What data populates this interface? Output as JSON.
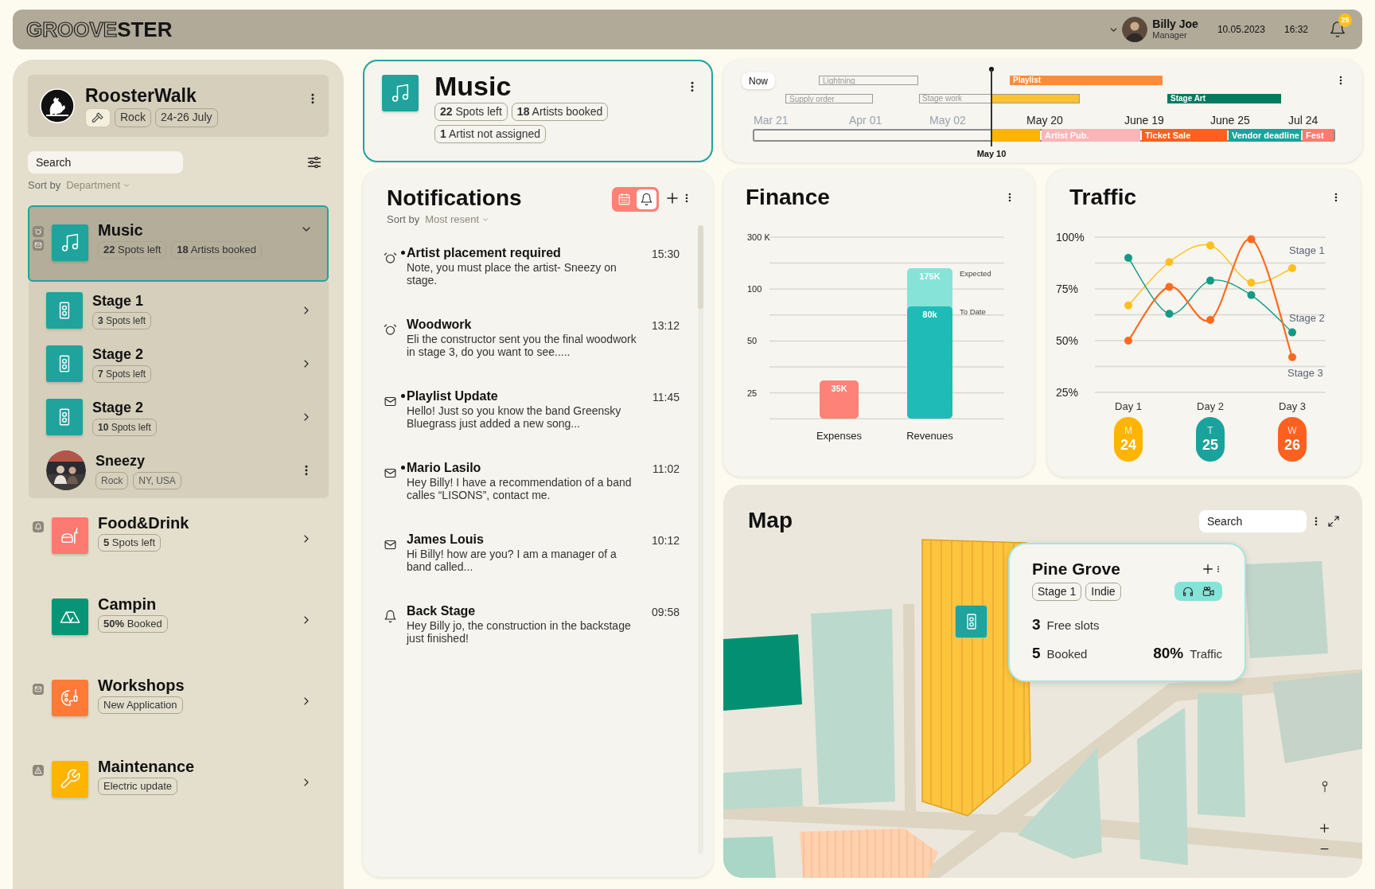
{
  "header": {
    "logo_outline": "GROOVE",
    "logo_solid": "STER",
    "user": {
      "name": "Billy Joe",
      "role": "Manager"
    },
    "date": "10.05.2023",
    "time": "16:32",
    "notification_count": "25"
  },
  "sidebar": {
    "festival": {
      "name": "RoosterWalk",
      "tags": [
        "Rock",
        "24-26 July"
      ]
    },
    "search": {
      "placeholder": "Search"
    },
    "sort": {
      "label": "Sort by",
      "value": "Department"
    },
    "items": [
      {
        "kind": "department",
        "title": "Music",
        "badges": [
          "**22** Spots left",
          "**18** Artists booked"
        ],
        "color": "#1fa39c",
        "selected": true,
        "expanded": true,
        "children": [
          {
            "kind": "stage",
            "title": "Stage 1",
            "badges": [
              "**3** Spots left"
            ]
          },
          {
            "kind": "stage",
            "title": "Stage 2",
            "badges": [
              "**7** Spots left"
            ]
          },
          {
            "kind": "stage",
            "title": "Stage 2",
            "badges": [
              "**10** Spots left"
            ]
          },
          {
            "kind": "artist",
            "title": "Sneezy",
            "badges": [
              "Rock",
              "NY, USA"
            ]
          }
        ]
      },
      {
        "kind": "department",
        "title": "Food&Drink",
        "badges": [
          "**5** Spots left"
        ],
        "color": "#fd7a72",
        "selected": false,
        "expanded": false
      },
      {
        "kind": "department",
        "title": "Campin",
        "badges": [
          "**50%** Booked"
        ],
        "color": "#079477",
        "selected": false,
        "expanded": false
      },
      {
        "kind": "department",
        "title": "Workshops",
        "badges": [
          "New Application"
        ],
        "color": "#ff7a37",
        "selected": false,
        "expanded": false
      },
      {
        "kind": "department",
        "title": "Maintenance",
        "badges": [
          "Electric update"
        ],
        "color": "#ffb400",
        "selected": false,
        "expanded": false
      }
    ]
  },
  "music_card": {
    "title": "Music",
    "badges": [
      "**22** Spots left",
      "**18** Artists booked",
      "**1** Artist not assigned"
    ]
  },
  "notifications": {
    "title": "Notifications",
    "sort": {
      "label": "Sort by",
      "value": "Most resent"
    },
    "view_toggle": [
      {
        "selected": false
      },
      {
        "selected": true
      }
    ],
    "items": [
      {
        "unread": true,
        "title": "Artist placement required",
        "body": "Note, you must place the artist- Sneezy on stage.",
        "time": "15:30"
      },
      {
        "unread": false,
        "title": "Woodwork",
        "body": "Eli the constructor sent you the final woodwork in stage 3, do you want to see.....",
        "time": "13:12"
      },
      {
        "unread": true,
        "title": "Playlist Update",
        "body": "Hello! Just so you know the band Greensky Bluegrass just added a new song...",
        "time": "11:45"
      },
      {
        "unread": true,
        "title": "Mario Lasilo",
        "body": "Hey Billy! I have a recommendation of a band calles “LISONS”, contact me.",
        "time": "11:02"
      },
      {
        "unread": false,
        "title": "James Louis",
        "body": "Hi Billy! how are you? I am a manager of a band called...",
        "time": "10:12"
      },
      {
        "unread": false,
        "title": "Back Stage",
        "body": "Hey Billy jo, the construction in the backstage just finished!",
        "time": "09:58"
      }
    ]
  },
  "timeline": {
    "now_label": "Now",
    "current_date": "May 10",
    "tasks": [
      {
        "label": "Lightning",
        "kind": "done"
      },
      {
        "label": "Supply order",
        "kind": "done"
      },
      {
        "label": "Stage work",
        "kind": "active",
        "color": "#ffc12f"
      },
      {
        "label": "Playlist",
        "kind": "planned",
        "color": "#ff8c3a"
      },
      {
        "label": "Stage Art",
        "kind": "planned",
        "color": "#067a5f"
      }
    ],
    "dates": [
      {
        "label": "Mar 21",
        "past": true
      },
      {
        "label": "Apr 01",
        "past": true
      },
      {
        "label": "May 02",
        "past": true
      },
      {
        "label": "May 20",
        "past": false
      },
      {
        "label": "June 19",
        "past": false
      },
      {
        "label": "June 25",
        "past": false
      },
      {
        "label": "Jul 24",
        "past": false
      }
    ],
    "phases": [
      {
        "color": "#ffb400"
      },
      {
        "label": "Artist Pub.",
        "color": "#fcb4b6"
      },
      {
        "label": "Ticket Sale",
        "color": "#ff5f1f"
      },
      {
        "label": "Vendor deadline",
        "color": "#1aa39c"
      },
      {
        "label": "Fest",
        "color": "#ff7a70"
      }
    ]
  },
  "finance": {
    "title": "Finance",
    "axis_labels": [
      "300 K",
      "100",
      "50",
      "25"
    ],
    "bars": [
      {
        "label": "Expenses",
        "segments": [
          {
            "value_label": "35K",
            "color": "#ff8279"
          }
        ]
      },
      {
        "label": "Revenues",
        "segments": [
          {
            "name": "Expected",
            "value_label": "175K",
            "color": "#86e3d8"
          },
          {
            "name": "To Date",
            "value_label": "80k",
            "color": "#1fbcb7"
          }
        ]
      }
    ]
  },
  "traffic": {
    "title": "Traffic",
    "chart_data": {
      "type": "line",
      "categories": [
        "Day 1",
        null,
        "Day 2",
        null,
        "Day 3"
      ],
      "yticks": [
        {
          "value": 25,
          "label": "25%"
        },
        {
          "value": 50,
          "label": "50%"
        },
        {
          "value": 75,
          "label": "75%"
        },
        {
          "value": 100,
          "label": "100%"
        }
      ],
      "ylim": [
        25,
        100
      ],
      "series": [
        {
          "name": "Stage 1",
          "color": "#ffbf1f",
          "marker": true,
          "values": [
            67,
            88,
            96,
            78,
            85
          ]
        },
        {
          "name": "Stage 2",
          "color": "#139a85",
          "marker": true,
          "values": [
            90,
            63,
            79,
            72,
            54
          ]
        },
        {
          "name": "Stage 3",
          "color": "#ff6a1f",
          "marker": true,
          "values": [
            50,
            76,
            60,
            99,
            42
          ]
        }
      ]
    },
    "days": [
      {
        "letter": "M",
        "date": "24",
        "color": "#ffb400"
      },
      {
        "letter": "T",
        "date": "25",
        "color": "#1aa39c"
      },
      {
        "letter": "W",
        "date": "26",
        "color": "#ff5f1f"
      }
    ]
  },
  "map": {
    "title": "Map",
    "search": {
      "placeholder": "Search"
    },
    "popup": {
      "title": "Pine Grove",
      "tags": [
        "Stage 1",
        "Indie"
      ],
      "stats": [
        {
          "value": "3",
          "label": "Free slots"
        },
        {
          "value": "5",
          "label": "Booked"
        },
        {
          "value": "80%",
          "label": "Traffic"
        }
      ]
    }
  }
}
